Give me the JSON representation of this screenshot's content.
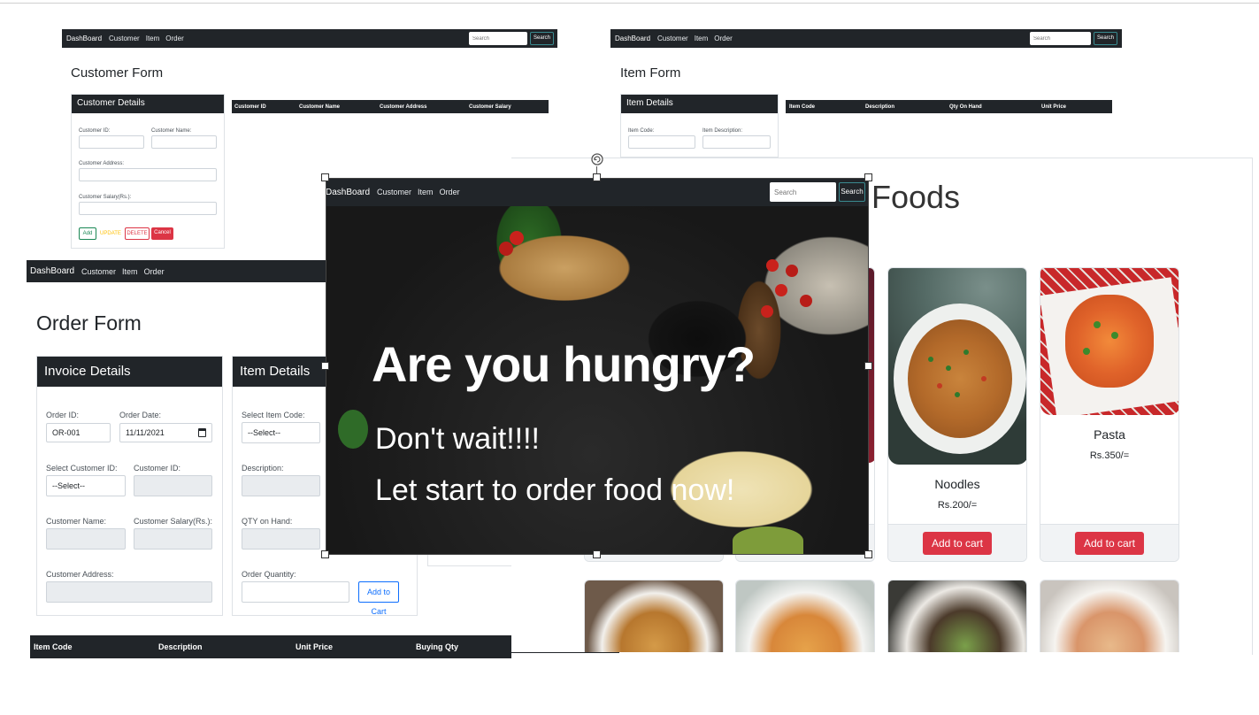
{
  "nav": {
    "brand": "DashBoard",
    "links": [
      "Customer",
      "Item",
      "Order"
    ],
    "search_placeholder": "Search",
    "search_button": "Search"
  },
  "customer_form": {
    "title": "Customer Form",
    "card_title": "Customer Details",
    "labels": {
      "id": "Customer ID:",
      "name": "Customer Name:",
      "address": "Customer Address:",
      "salary": "Customer Salary(Rs.):"
    },
    "buttons": {
      "add": "Add",
      "update": "UPDATE",
      "delete": "DELETE",
      "cancel": "Cancel"
    },
    "table_headers": [
      "Customer ID",
      "Customer Name",
      "Customer Address",
      "Customer Salary"
    ]
  },
  "item_form": {
    "title": "Item Form",
    "card_title": "Item Details",
    "labels": {
      "code": "Item Code:",
      "description": "Item Description:"
    },
    "table_headers": [
      "Item Code",
      "Description",
      "Qty On Hand",
      "Unit Price"
    ]
  },
  "order_form": {
    "title": "Order Form",
    "invoice_card_title": "Invoice Details",
    "item_card_title": "Item Details",
    "labels": {
      "order_id": "Order ID:",
      "order_date": "Order Date:",
      "select_customer": "Select Customer ID:",
      "customer_id": "Customer ID:",
      "customer_name": "Customer Name:",
      "customer_salary": "Customer Salary(Rs.):",
      "customer_address": "Customer Address:",
      "select_item": "Select Item Code:",
      "description": "Description:",
      "qty_on_hand": "QTY on Hand:",
      "order_qty": "Order Quantity:"
    },
    "values": {
      "order_id": "OR-001",
      "order_date": "11/11/2021",
      "select_customer": "--Select--",
      "select_item": "--Select--"
    },
    "add_to_cart": "Add to Cart",
    "table_headers": [
      "Item Code",
      "Description",
      "Unit Price",
      "Buying Qty"
    ]
  },
  "foods_page": {
    "heading_fragment": "Foods",
    "add_to_cart": "Add to cart",
    "items": [
      {
        "name": "Noodles",
        "price": "Rs.200/="
      },
      {
        "name": "Pasta",
        "price": "Rs.350/="
      }
    ]
  },
  "hero": {
    "headline": "Are you hungry?",
    "line1": "Don't wait!!!!",
    "line2": "Let start to order food now!"
  },
  "colors": {
    "navbar": "#212529",
    "cancel_red": "#dc3545",
    "update_orange": "#ffc107",
    "add_green": "#198754",
    "link_blue": "#0d6efd"
  }
}
